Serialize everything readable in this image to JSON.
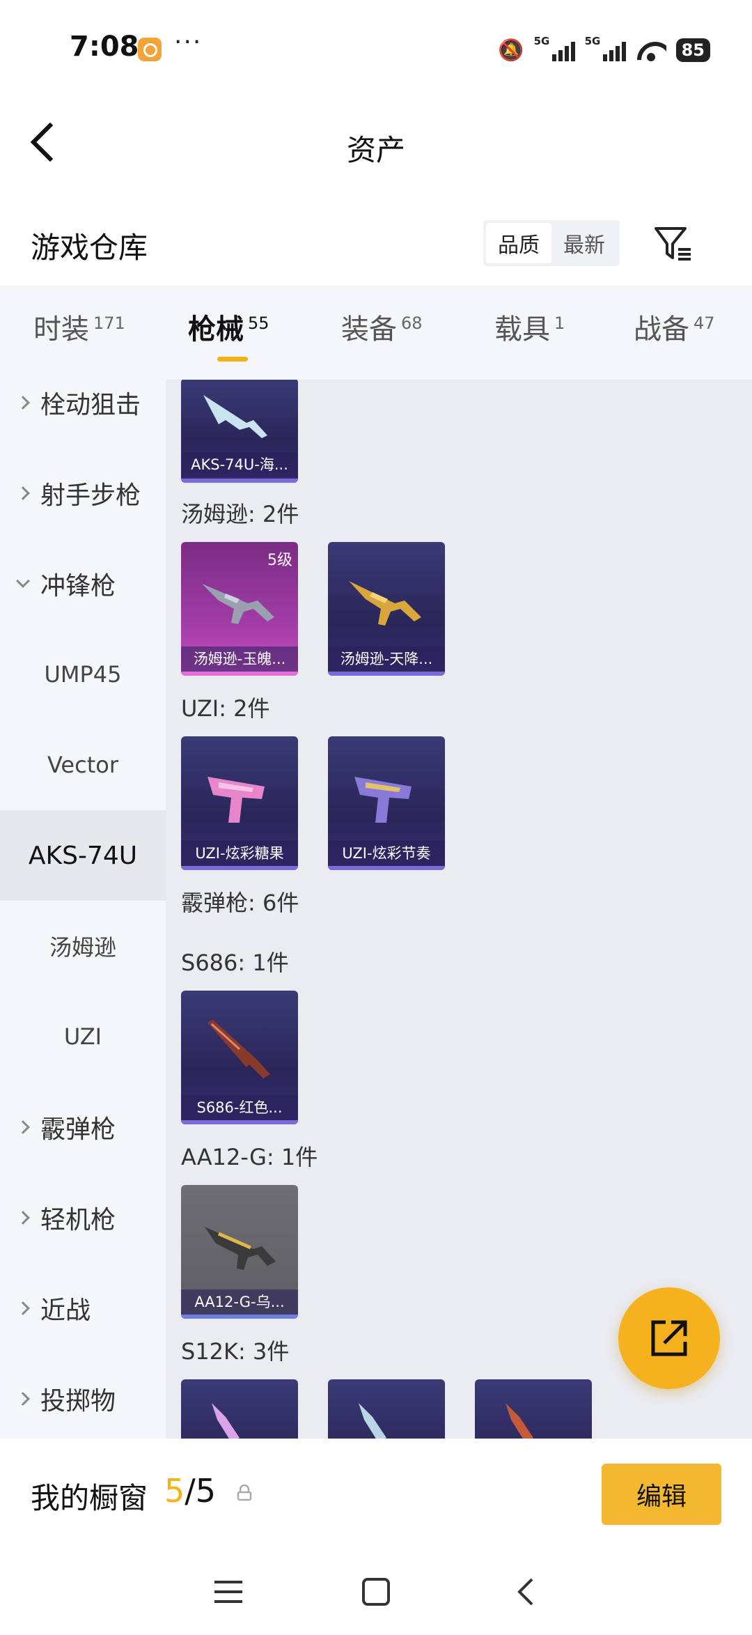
{
  "status_bar": {
    "time": "7:08",
    "more": "···",
    "network_1": "5G",
    "network_2": "5G",
    "battery": "85"
  },
  "header": {
    "title": "资产"
  },
  "warehouse": {
    "title": "游戏仓库",
    "sort_options": [
      "品质",
      "最新"
    ],
    "active_sort": "品质"
  },
  "tabs": [
    {
      "label": "时装",
      "count": "171"
    },
    {
      "label": "枪械",
      "count": "55"
    },
    {
      "label": "装备",
      "count": "68"
    },
    {
      "label": "载具",
      "count": "1"
    },
    {
      "label": "战备",
      "count": "47"
    }
  ],
  "active_tab": "枪械",
  "sidebar": {
    "items": [
      {
        "label": "栓动狙击",
        "type": "category"
      },
      {
        "label": "射手步枪",
        "type": "category"
      },
      {
        "label": "冲锋枪",
        "type": "category",
        "expanded": true
      },
      {
        "label": "UMP45",
        "type": "sub"
      },
      {
        "label": "Vector",
        "type": "sub"
      },
      {
        "label": "AKS-74U",
        "type": "sub",
        "selected": true
      },
      {
        "label": "汤姆逊",
        "type": "sub"
      },
      {
        "label": "UZI",
        "type": "sub"
      },
      {
        "label": "霰弹枪",
        "type": "category"
      },
      {
        "label": "轻机枪",
        "type": "category"
      },
      {
        "label": "近战",
        "type": "category"
      },
      {
        "label": "投掷物",
        "type": "category"
      }
    ]
  },
  "content": {
    "top_card": {
      "name": "AKS-74U-海..."
    },
    "groups": [
      {
        "label": "汤姆逊: 2件",
        "cards": [
          {
            "name": "汤姆逊-玉魄...",
            "level": "5级"
          },
          {
            "name": "汤姆逊-天降..."
          }
        ]
      },
      {
        "label": "UZI: 2件",
        "cards": [
          {
            "name": "UZI-炫彩糖果"
          },
          {
            "name": "UZI-炫彩节奏"
          }
        ]
      },
      {
        "label": "霰弹枪: 6件"
      },
      {
        "label": "S686: 1件",
        "cards": [
          {
            "name": "S686-红色..."
          }
        ]
      },
      {
        "label": "AA12-G: 1件",
        "cards": [
          {
            "name": "AA12-G-乌..."
          }
        ]
      },
      {
        "label": "S12K: 3件"
      }
    ]
  },
  "bottom": {
    "label": "我的橱窗",
    "current": "5",
    "total": "/5",
    "edit": "编辑"
  }
}
